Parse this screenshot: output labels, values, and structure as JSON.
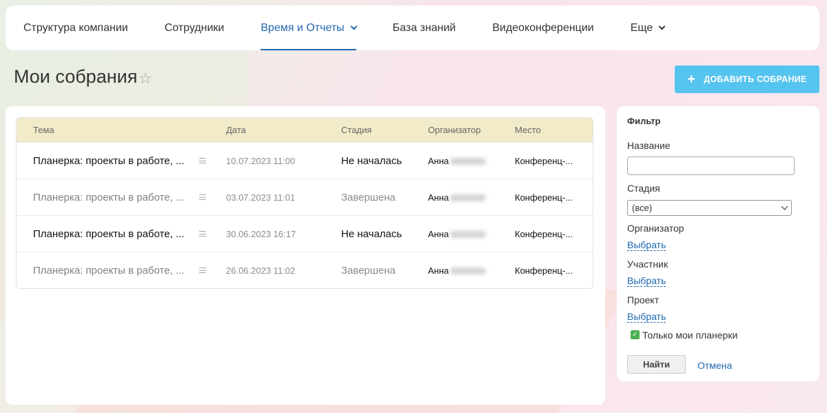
{
  "nav": {
    "items": [
      {
        "label": "Структура компании",
        "active": false,
        "dropdown": false
      },
      {
        "label": "Сотрудники",
        "active": false,
        "dropdown": false
      },
      {
        "label": "Время и Отчеты",
        "active": true,
        "dropdown": true
      },
      {
        "label": "База знаний",
        "active": false,
        "dropdown": false
      },
      {
        "label": "Видеоконференции",
        "active": false,
        "dropdown": false
      },
      {
        "label": "Еще",
        "active": false,
        "dropdown": true
      }
    ]
  },
  "page": {
    "title": "Мои собрания",
    "add_button": "ДОБАВИТЬ СОБРАНИЕ"
  },
  "table": {
    "columns": [
      "Тема",
      "Дата",
      "Стадия",
      "Организатор",
      "Место"
    ],
    "rows": [
      {
        "topic": "Планерка: проекты в работе, ...",
        "date": "10.07.2023 11:00",
        "stage": "Не началась",
        "organizer": "Анна",
        "place": "Конференц-...",
        "done": false
      },
      {
        "topic": "Планерка: проекты в работе, ...",
        "date": "03.07.2023 11:01",
        "stage": "Завершена",
        "organizer": "Анна",
        "place": "Конференц-...",
        "done": true
      },
      {
        "topic": "Планерка: проекты в работе, ...",
        "date": "30.06.2023 16:17",
        "stage": "Не началась",
        "organizer": "Анна",
        "place": "Конференц-...",
        "done": false
      },
      {
        "topic": "Планерка: проекты в работе, ...",
        "date": "26.06.2023 11:02",
        "stage": "Завершена",
        "organizer": "Анна",
        "place": "Конференц-...",
        "done": true
      }
    ]
  },
  "filter": {
    "title": "Фильтр",
    "name_label": "Название",
    "name_value": "",
    "stage_label": "Стадия",
    "stage_value": "(все)",
    "organizer_label": "Организатор",
    "participant_label": "Участник",
    "project_label": "Проект",
    "select_link": "Выбрать",
    "only_mine_label": "Только мои планерки",
    "only_mine_checked": true,
    "find_button": "Найти",
    "cancel_link": "Отмена"
  },
  "colors": {
    "accent": "#2067b0",
    "add_button": "#55c4ef",
    "table_header": "#f1ebc9",
    "checkbox": "#4caf50"
  }
}
